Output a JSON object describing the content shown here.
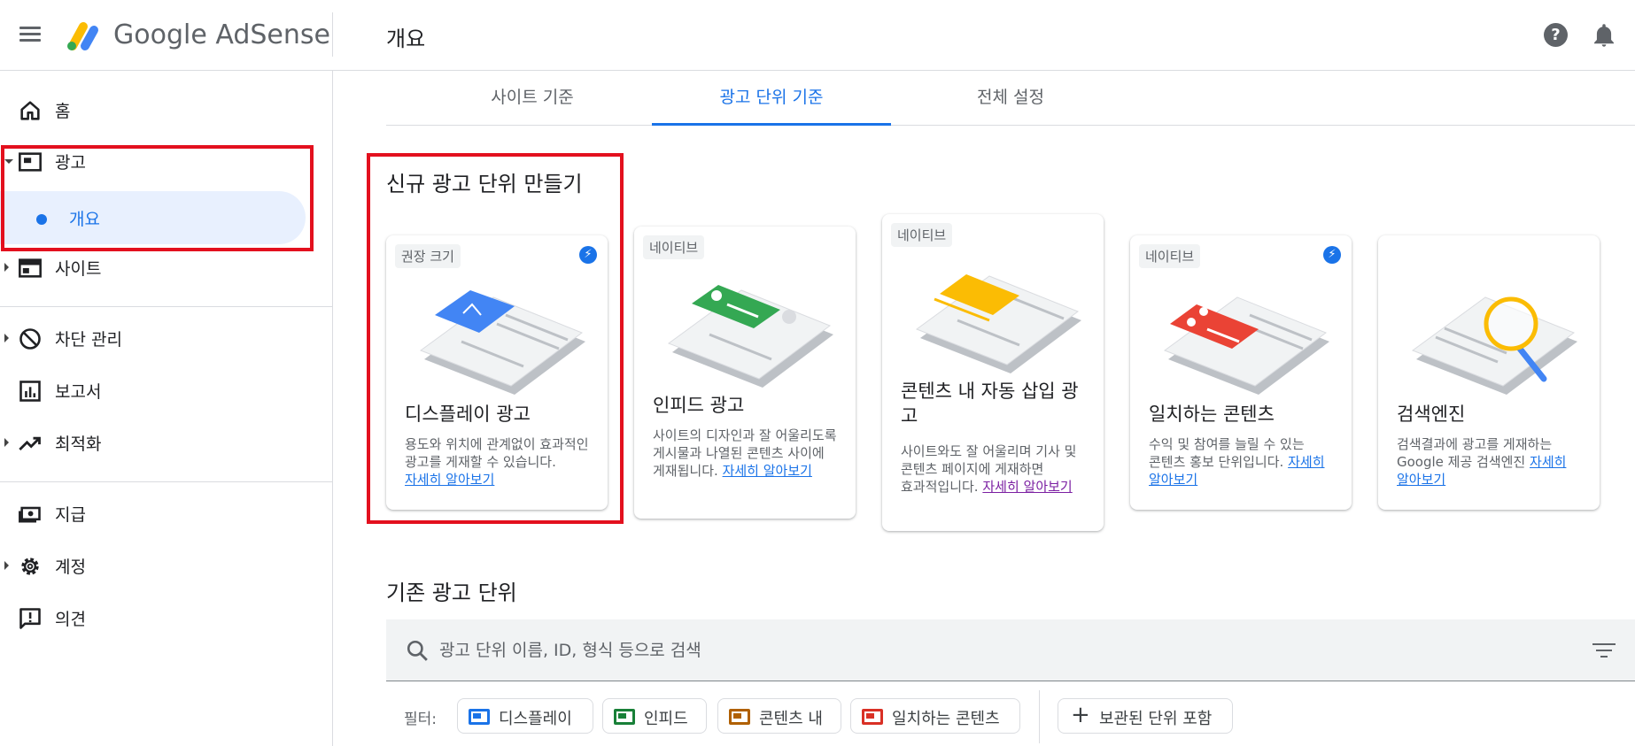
{
  "app": {
    "brand": "Google AdSense",
    "page_title": "개요"
  },
  "sidebar": {
    "items": [
      {
        "label": "홈"
      },
      {
        "label": "광고"
      },
      {
        "label": "개요"
      },
      {
        "label": "사이트"
      },
      {
        "label": "차단 관리"
      },
      {
        "label": "보고서"
      },
      {
        "label": "최적화"
      },
      {
        "label": "지급"
      },
      {
        "label": "계정"
      },
      {
        "label": "의견"
      }
    ]
  },
  "tabs": [
    {
      "label": "사이트 기준"
    },
    {
      "label": "광고 단위 기준",
      "active": true
    },
    {
      "label": "전체 설정"
    }
  ],
  "create_section": {
    "title": "신규 광고 단위 만들기",
    "cards": [
      {
        "badge": "권장 크기",
        "title": "디스플레이 광고",
        "desc": "용도와 위치에 관계없이 효과적인 광고를 게재할 수 있습니다.",
        "link": "자세히 알아보기",
        "accent": "#4285f4"
      },
      {
        "badge": "네이티브",
        "title": "인피드 광고",
        "desc": "사이트의 디자인과 잘 어울리도록 게시물과 나열된 콘텐츠 사이에 게재됩니다.",
        "link": "자세히 알아보기",
        "accent": "#34a853"
      },
      {
        "badge": "네이티브",
        "title": "콘텐츠 내 자동 삽입 광고",
        "desc": "사이트와도 잘 어울리며 기사 및 콘텐츠 페이지에 게재하면 효과적입니다.",
        "link": "자세히 알아보기",
        "accent": "#fbbc04"
      },
      {
        "badge": "네이티브",
        "title": "일치하는 콘텐츠",
        "desc": "수익 및 참여를 늘릴 수 있는 콘텐츠 홍보 단위입니다.",
        "link": "자세히 알아보기",
        "accent": "#ea4335"
      },
      {
        "badge": "",
        "title": "검색엔진",
        "desc": "검색결과에 광고를 게재하는 Google 제공 검색엔진",
        "link": "자세히 알아보기",
        "accent": "#fbbc04"
      }
    ]
  },
  "existing_section": {
    "title": "기존 광고 단위",
    "search_placeholder": "광고 단위 이름, ID, 형식 등으로 검색",
    "filter_label": "필터:",
    "chips": [
      {
        "label": "디스플레이",
        "color": "#1a73e8"
      },
      {
        "label": "인피드",
        "color": "#188038"
      },
      {
        "label": "콘텐츠 내",
        "color": "#b06000"
      },
      {
        "label": "일치하는 콘텐츠",
        "color": "#d93025"
      }
    ],
    "archived_chip": "보관된 단위 포함"
  }
}
